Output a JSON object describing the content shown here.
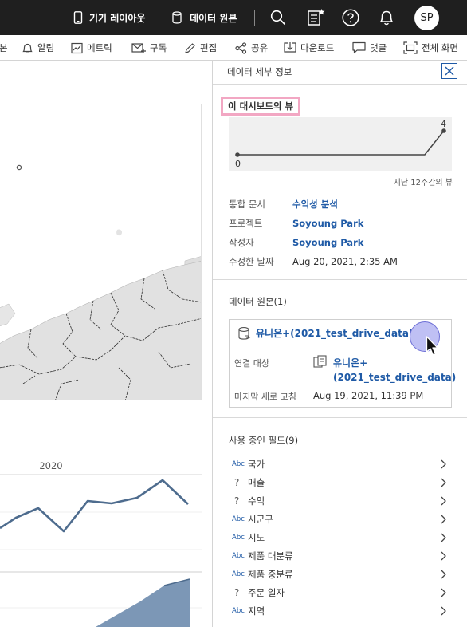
{
  "topbar": {
    "device_layout": "기기 레이아웃",
    "data_source": "데이터 원본",
    "avatar": "SP"
  },
  "toolbar": {
    "partial": "본",
    "alerts": "알림",
    "metrics": "메트릭",
    "subscribe": "구독",
    "edit": "편집",
    "share": "공유",
    "download": "다운로드",
    "comments": "댓글",
    "fullscreen": "전체 화면"
  },
  "dashboard": {
    "year_label": "2020"
  },
  "panel": {
    "title": "데이터 세부 정보",
    "views_label": "이 대시보드의 뷰",
    "views_note": "지난 12주간의 뷰",
    "spark_min": "0",
    "spark_max": "4",
    "meta": [
      {
        "key": "통합 문서",
        "value": "수익성 분석",
        "link": true
      },
      {
        "key": "프로젝트",
        "value": "Soyoung Park",
        "link": true
      },
      {
        "key": "작성자",
        "value": "Soyoung Park",
        "link": true
      },
      {
        "key": "수정한 날짜",
        "value": "Aug 20, 2021, 2:35 AM",
        "link": false
      }
    ],
    "datasources_title": "데이터 원본(1)",
    "datasource": {
      "name": "유니온+(2021_test_drive_data)",
      "connect_key": "연결 대상",
      "connect_line1": "유니온+",
      "connect_line2": "(2021_test_drive_data)",
      "refresh_key": "마지막 새로 고침",
      "refresh_value": "Aug 19, 2021, 11:39 PM"
    },
    "fields_title": "사용 중인 필드(9)",
    "fields": [
      {
        "type": "Abc",
        "name": "국가"
      },
      {
        "type": "?",
        "name": "매출"
      },
      {
        "type": "?",
        "name": "수익"
      },
      {
        "type": "Abc",
        "name": "시군구"
      },
      {
        "type": "Abc",
        "name": "시도"
      },
      {
        "type": "Abc",
        "name": "제품 대분류"
      },
      {
        "type": "Abc",
        "name": "제품 중분류"
      },
      {
        "type": "?",
        "name": "주문 일자"
      },
      {
        "type": "Abc",
        "name": "지역"
      }
    ]
  }
}
